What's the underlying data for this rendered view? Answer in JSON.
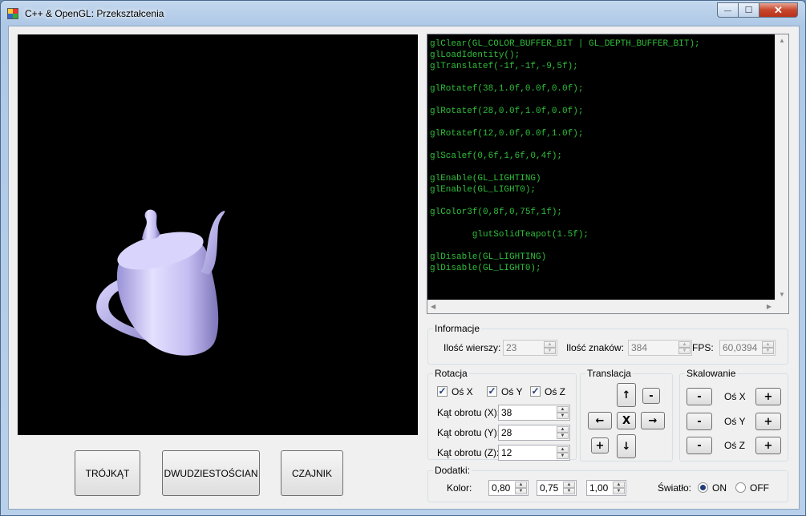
{
  "window": {
    "title": "C++ & OpenGL: Przekształcenia",
    "min_glyph": "—",
    "max_glyph": "☐",
    "close_glyph": "✕"
  },
  "buttons": {
    "triangle": "TRÓJKĄT",
    "icosahedron": "DWUDZIESTOŚCIAN",
    "teapot": "CZAJNIK"
  },
  "code": {
    "lines": [
      "glClear(GL_COLOR_BUFFER_BIT | GL_DEPTH_BUFFER_BIT);",
      "glLoadIdentity();",
      "glTranslatef(-1f,-1f,-9,5f);",
      "",
      "glRotatef(38,1.0f,0.0f,0.0f);",
      "",
      "glRotatef(28,0.0f,1.0f,0.0f);",
      "",
      "glRotatef(12,0.0f,0.0f,1.0f);",
      "",
      "glScalef(0,6f,1,6f,0,4f);",
      "",
      "glEnable(GL_LIGHTING)",
      "glEnable(GL_LIGHT0);",
      "",
      "glColor3f(0,8f,0,75f,1f);",
      "",
      "        glutSolidTeapot(1.5f);",
      "",
      "glDisable(GL_LIGHTING)",
      "glDisable(GL_LIGHT0);"
    ],
    "text_color": "#2fbf3a"
  },
  "info": {
    "title": "Informacje",
    "lines_label": "Ilość wierszy:",
    "lines_value": "23",
    "chars_label": "Ilość znaków:",
    "chars_value": "384",
    "fps_label": "FPS:",
    "fps_value": "60,0394"
  },
  "rotation": {
    "title": "Rotacja",
    "axis_x": "Oś X",
    "axis_y": "Oś Y",
    "axis_z": "Oś Z",
    "check_glyph": "✓",
    "angle_x_label": "Kąt obrotu (X):",
    "angle_x_value": "38",
    "angle_y_label": "Kąt obrotu (Y):",
    "angle_y_value": "28",
    "angle_z_label": "Kąt obrotu (Z):",
    "angle_z_value": "12"
  },
  "translation": {
    "title": "Translacja",
    "up": "↑",
    "minus": "-",
    "left": "←",
    "center": "X",
    "right": "→",
    "plus": "+",
    "down": "↓"
  },
  "scaling": {
    "title": "Skalowanie",
    "axis_x": "Oś X",
    "axis_y": "Oś Y",
    "axis_z": "Oś Z",
    "minus": "-",
    "plus": "+"
  },
  "extras": {
    "title": "Dodatki:",
    "color_label": "Kolor:",
    "r_value": "0,80",
    "g_value": "0,75",
    "b_value": "1,00",
    "light_label": "Światło:",
    "on_label": "ON",
    "off_label": "OFF"
  },
  "colors": {
    "teapot_fill": "#c7c1f2",
    "gl_background": "#000000"
  }
}
